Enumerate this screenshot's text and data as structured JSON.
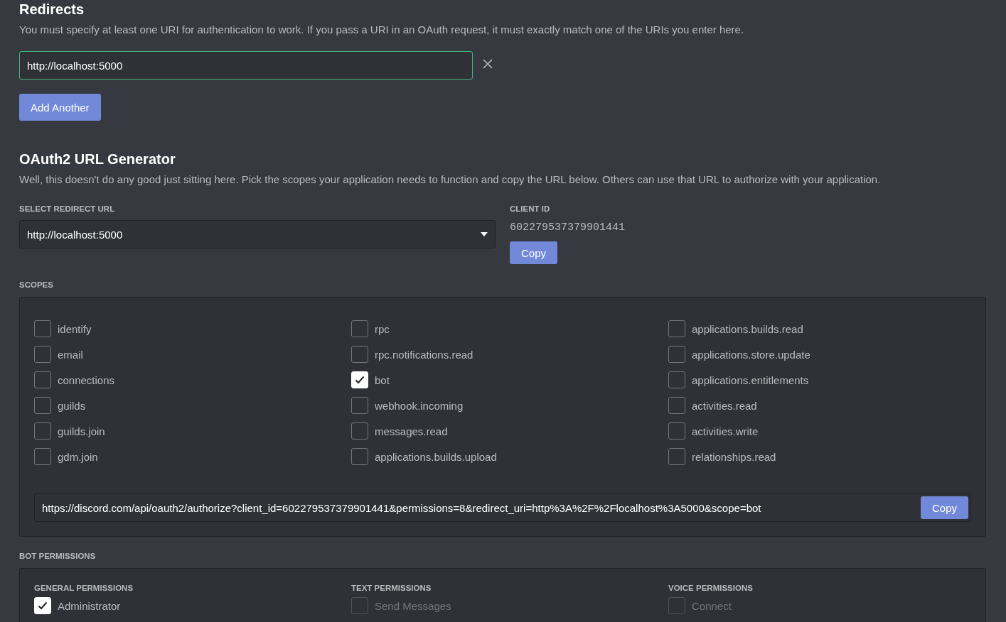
{
  "redirects": {
    "title": "Redirects",
    "description": "You must specify at least one URI for authentication to work. If you pass a URI in an OAuth request, it must exactly match one of the URIs you enter here.",
    "uris": [
      {
        "value": "http://localhost:5000"
      }
    ],
    "add_button": "Add Another"
  },
  "url_generator": {
    "title": "OAuth2 URL Generator",
    "description": "Well, this doesn't do any good just sitting here. Pick the scopes your application needs to function and copy the URL below. Others can use that URL to authorize with your application.",
    "redirect_label": "SELECT REDIRECT URL",
    "redirect_value": "http://localhost:5000",
    "client_id_label": "CLIENT ID",
    "client_id": "602279537379901441",
    "client_copy": "Copy"
  },
  "scopes": {
    "label": "SCOPES",
    "columns": [
      [
        {
          "label": "identify",
          "checked": false
        },
        {
          "label": "email",
          "checked": false
        },
        {
          "label": "connections",
          "checked": false
        },
        {
          "label": "guilds",
          "checked": false
        },
        {
          "label": "guilds.join",
          "checked": false
        },
        {
          "label": "gdm.join",
          "checked": false
        }
      ],
      [
        {
          "label": "rpc",
          "checked": false
        },
        {
          "label": "rpc.notifications.read",
          "checked": false
        },
        {
          "label": "bot",
          "checked": true
        },
        {
          "label": "webhook.incoming",
          "checked": false
        },
        {
          "label": "messages.read",
          "checked": false
        },
        {
          "label": "applications.builds.upload",
          "checked": false
        }
      ],
      [
        {
          "label": "applications.builds.read",
          "checked": false
        },
        {
          "label": "applications.store.update",
          "checked": false
        },
        {
          "label": "applications.entitlements",
          "checked": false
        },
        {
          "label": "activities.read",
          "checked": false
        },
        {
          "label": "activities.write",
          "checked": false
        },
        {
          "label": "relationships.read",
          "checked": false
        }
      ]
    ],
    "url": "https://discord.com/api/oauth2/authorize?client_id=602279537379901441&permissions=8&redirect_uri=http%3A%2F%2Flocalhost%3A5000&scope=bot",
    "url_copy": "Copy"
  },
  "bot_permissions": {
    "label": "BOT PERMISSIONS",
    "columns": [
      {
        "heading": "GENERAL PERMISSIONS",
        "items": [
          {
            "label": "Administrator",
            "checked": true,
            "disabled": false
          }
        ]
      },
      {
        "heading": "TEXT PERMISSIONS",
        "items": [
          {
            "label": "Send Messages",
            "checked": false,
            "disabled": true
          }
        ]
      },
      {
        "heading": "VOICE PERMISSIONS",
        "items": [
          {
            "label": "Connect",
            "checked": false,
            "disabled": true
          }
        ]
      }
    ]
  }
}
